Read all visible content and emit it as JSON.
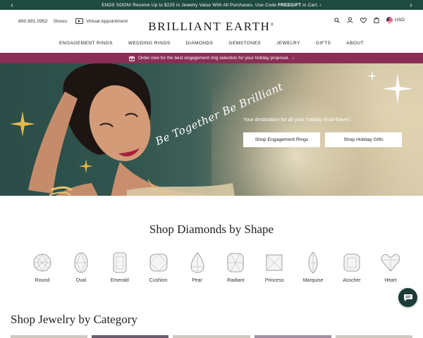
{
  "promo": {
    "text_before": "ENDS SOON! Receive Up to $225 in Jewelry Value With All Purchases. Use Code ",
    "code": "FREEGIFT",
    "text_after": " in Cart. ›",
    "prev_icon": "chevron-left-icon",
    "next_icon": "chevron-right-icon"
  },
  "header": {
    "phone": "800.691.0952",
    "stores": "Stores",
    "appointment": "Virtual Appointment",
    "logo": "BRILLIANT EARTH",
    "logo_mark": "®",
    "currency": "USD"
  },
  "nav": [
    "ENGAGEMENT RINGS",
    "WEDDING RINGS",
    "DIAMONDS",
    "GEMSTONES",
    "JEWELRY",
    "GIFTS",
    "ABOUT"
  ],
  "holiday_banner": {
    "text": "Order now for the best engagement ring selection for your holiday proposal.",
    "arrow": "›"
  },
  "hero": {
    "tagline": "Be Together Be Brilliant",
    "subtitle": "Your destination for all your holiday must-haves.",
    "button_1": "Shop Engagement Rings",
    "button_2": "Shop Holiday Gifts"
  },
  "shapes_section": {
    "title": "Shop Diamonds by Shape",
    "shapes": [
      "Round",
      "Oval",
      "Emerald",
      "Cushion",
      "Pear",
      "Radiant",
      "Princess",
      "Marquise",
      "Asscher",
      "Heart"
    ]
  },
  "category_section": {
    "title": "Shop Jewelry by Category"
  },
  "colors": {
    "promo_bg": "#1f4a40",
    "banner_bg": "#8a2e55",
    "chat_bg": "#1d3b39"
  }
}
